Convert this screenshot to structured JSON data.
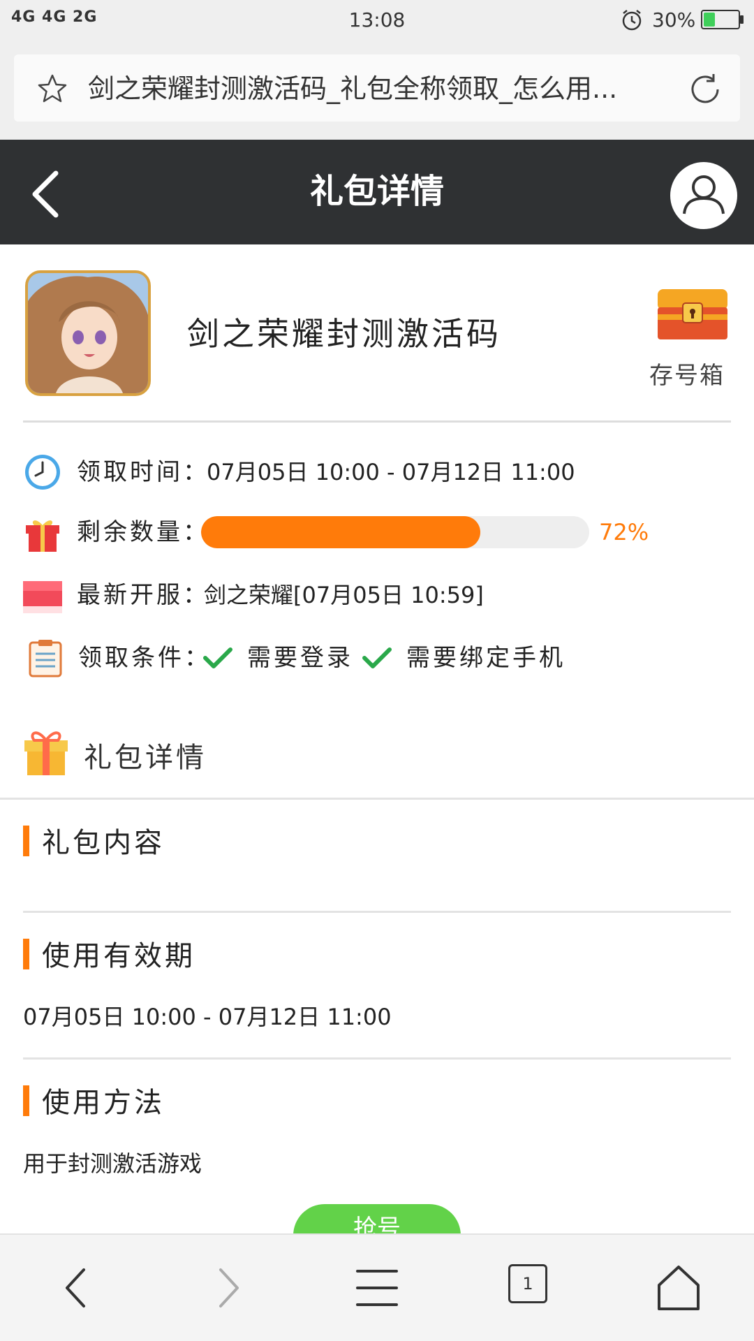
{
  "status_bar": {
    "signal": "4G 4G 2G",
    "time": "13:08",
    "battery": "30%",
    "battery_level": 0.3
  },
  "browser": {
    "address_text": "剑之荣耀封测激活码_礼包全称领取_怎么用..."
  },
  "header": {
    "title": "礼包详情"
  },
  "game": {
    "title": "剑之荣耀封测激活码",
    "save_box_label": "存号箱"
  },
  "info": {
    "time_label": "领取时间：",
    "time_value": "07月05日 10:00 - 07月12日 11:00",
    "remaining_label": "剩余数量：",
    "remaining_percent": 72,
    "remaining_text": "72%",
    "server_label": "最新开服：",
    "server_value": "剑之荣耀[07月05日 10:59]",
    "condition_label": "领取条件：",
    "conditions": [
      "需要登录",
      "需要绑定手机"
    ]
  },
  "details": {
    "section_title": "礼包详情",
    "content_title": "礼包内容",
    "validity_title": "使用有效期",
    "validity_value": "07月05日 10:00 - 07月12日 11:00",
    "usage_title": "使用方法",
    "usage_value": "用于封测激活游戏",
    "grab_button": "抢号"
  },
  "bottom_nav": {
    "tab_count": "1"
  },
  "colors": {
    "accent": "#ff7b0a",
    "header_bg": "#2f3133",
    "button_green": "#62d249"
  }
}
